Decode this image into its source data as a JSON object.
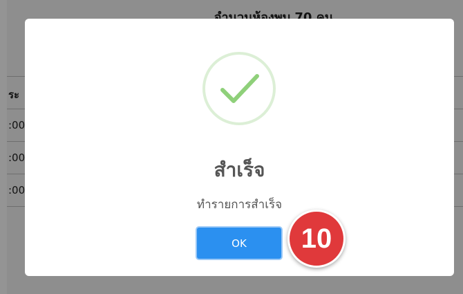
{
  "background": {
    "heading": "จำนวนห้องพบ 70 คน",
    "table": {
      "header": "ระ",
      "rows": [
        ":00",
        ":00",
        ":00"
      ]
    }
  },
  "modal": {
    "icon": "check-circle-icon",
    "title": "สำเร็จ",
    "message": "ทำรายการสำเร็จ",
    "ok_label": "OK"
  },
  "annotation": {
    "step_number": "10"
  },
  "colors": {
    "button": "#2b90f0",
    "success": "#8fd07a",
    "badge": "#e0393b"
  }
}
